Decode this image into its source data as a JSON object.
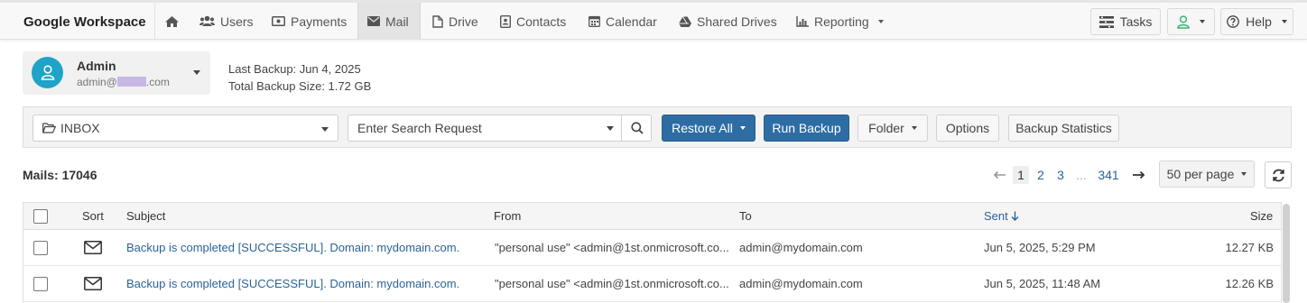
{
  "brand": "Google Workspace",
  "nav": [
    {
      "label": "",
      "icon": "home-icon"
    },
    {
      "label": "Users",
      "icon": "users-icon"
    },
    {
      "label": "Payments",
      "icon": "money-icon"
    },
    {
      "label": "Mail",
      "icon": "envelope-icon",
      "active": true
    },
    {
      "label": "Drive",
      "icon": "file-icon"
    },
    {
      "label": "Contacts",
      "icon": "contact-card-icon"
    },
    {
      "label": "Calendar",
      "icon": "calendar-icon"
    },
    {
      "label": "Shared Drives",
      "icon": "drive-icon"
    },
    {
      "label": "Reporting",
      "icon": "bar-chart-icon"
    }
  ],
  "top_right": {
    "tasks": "Tasks",
    "help": "Help"
  },
  "account": {
    "name": "Admin",
    "email_prefix": "admin@",
    "email_suffix": ".com"
  },
  "backup": {
    "last_backup": "Last Backup: Jun 4, 2025",
    "total_size": "Total Backup Size: 1.72 GB"
  },
  "toolbar": {
    "folder": "INBOX",
    "search_placeholder": "Enter Search Request",
    "restore_all": "Restore All",
    "run_backup": "Run Backup",
    "folder_btn": "Folder",
    "options": "Options",
    "backup_statistics": "Backup Statistics"
  },
  "mails": {
    "label": "Mails:",
    "count": "17046"
  },
  "pagination": {
    "pages": [
      "1",
      "2",
      "3",
      "...",
      "341"
    ],
    "per_page": "50 per page"
  },
  "table": {
    "headers": {
      "sort": "Sort",
      "subject": "Subject",
      "from": "From",
      "to": "To",
      "sent": "Sent",
      "size": "Size"
    },
    "rows": [
      {
        "subject": "Backup is completed [SUCCESSFUL]. Domain: mydomain.com.",
        "from": "\"personal use\" <admin@1st.onmicrosoft.co...",
        "to": "admin@mydomain.com",
        "sent": "Jun 5, 2025, 5:29 PM",
        "size": "12.27 KB"
      },
      {
        "subject": "Backup is completed [SUCCESSFUL]. Domain: mydomain.com.",
        "from": "\"personal use\" <admin@1st.onmicrosoft.co...",
        "to": "admin@mydomain.com",
        "sent": "Jun 5, 2025, 11:48 AM",
        "size": "12.26 KB"
      }
    ]
  },
  "colors": {
    "primary": "#2e6da4",
    "link": "#2a6496",
    "avatar": "#1fa3c7",
    "user_icon": "#3cb371"
  }
}
